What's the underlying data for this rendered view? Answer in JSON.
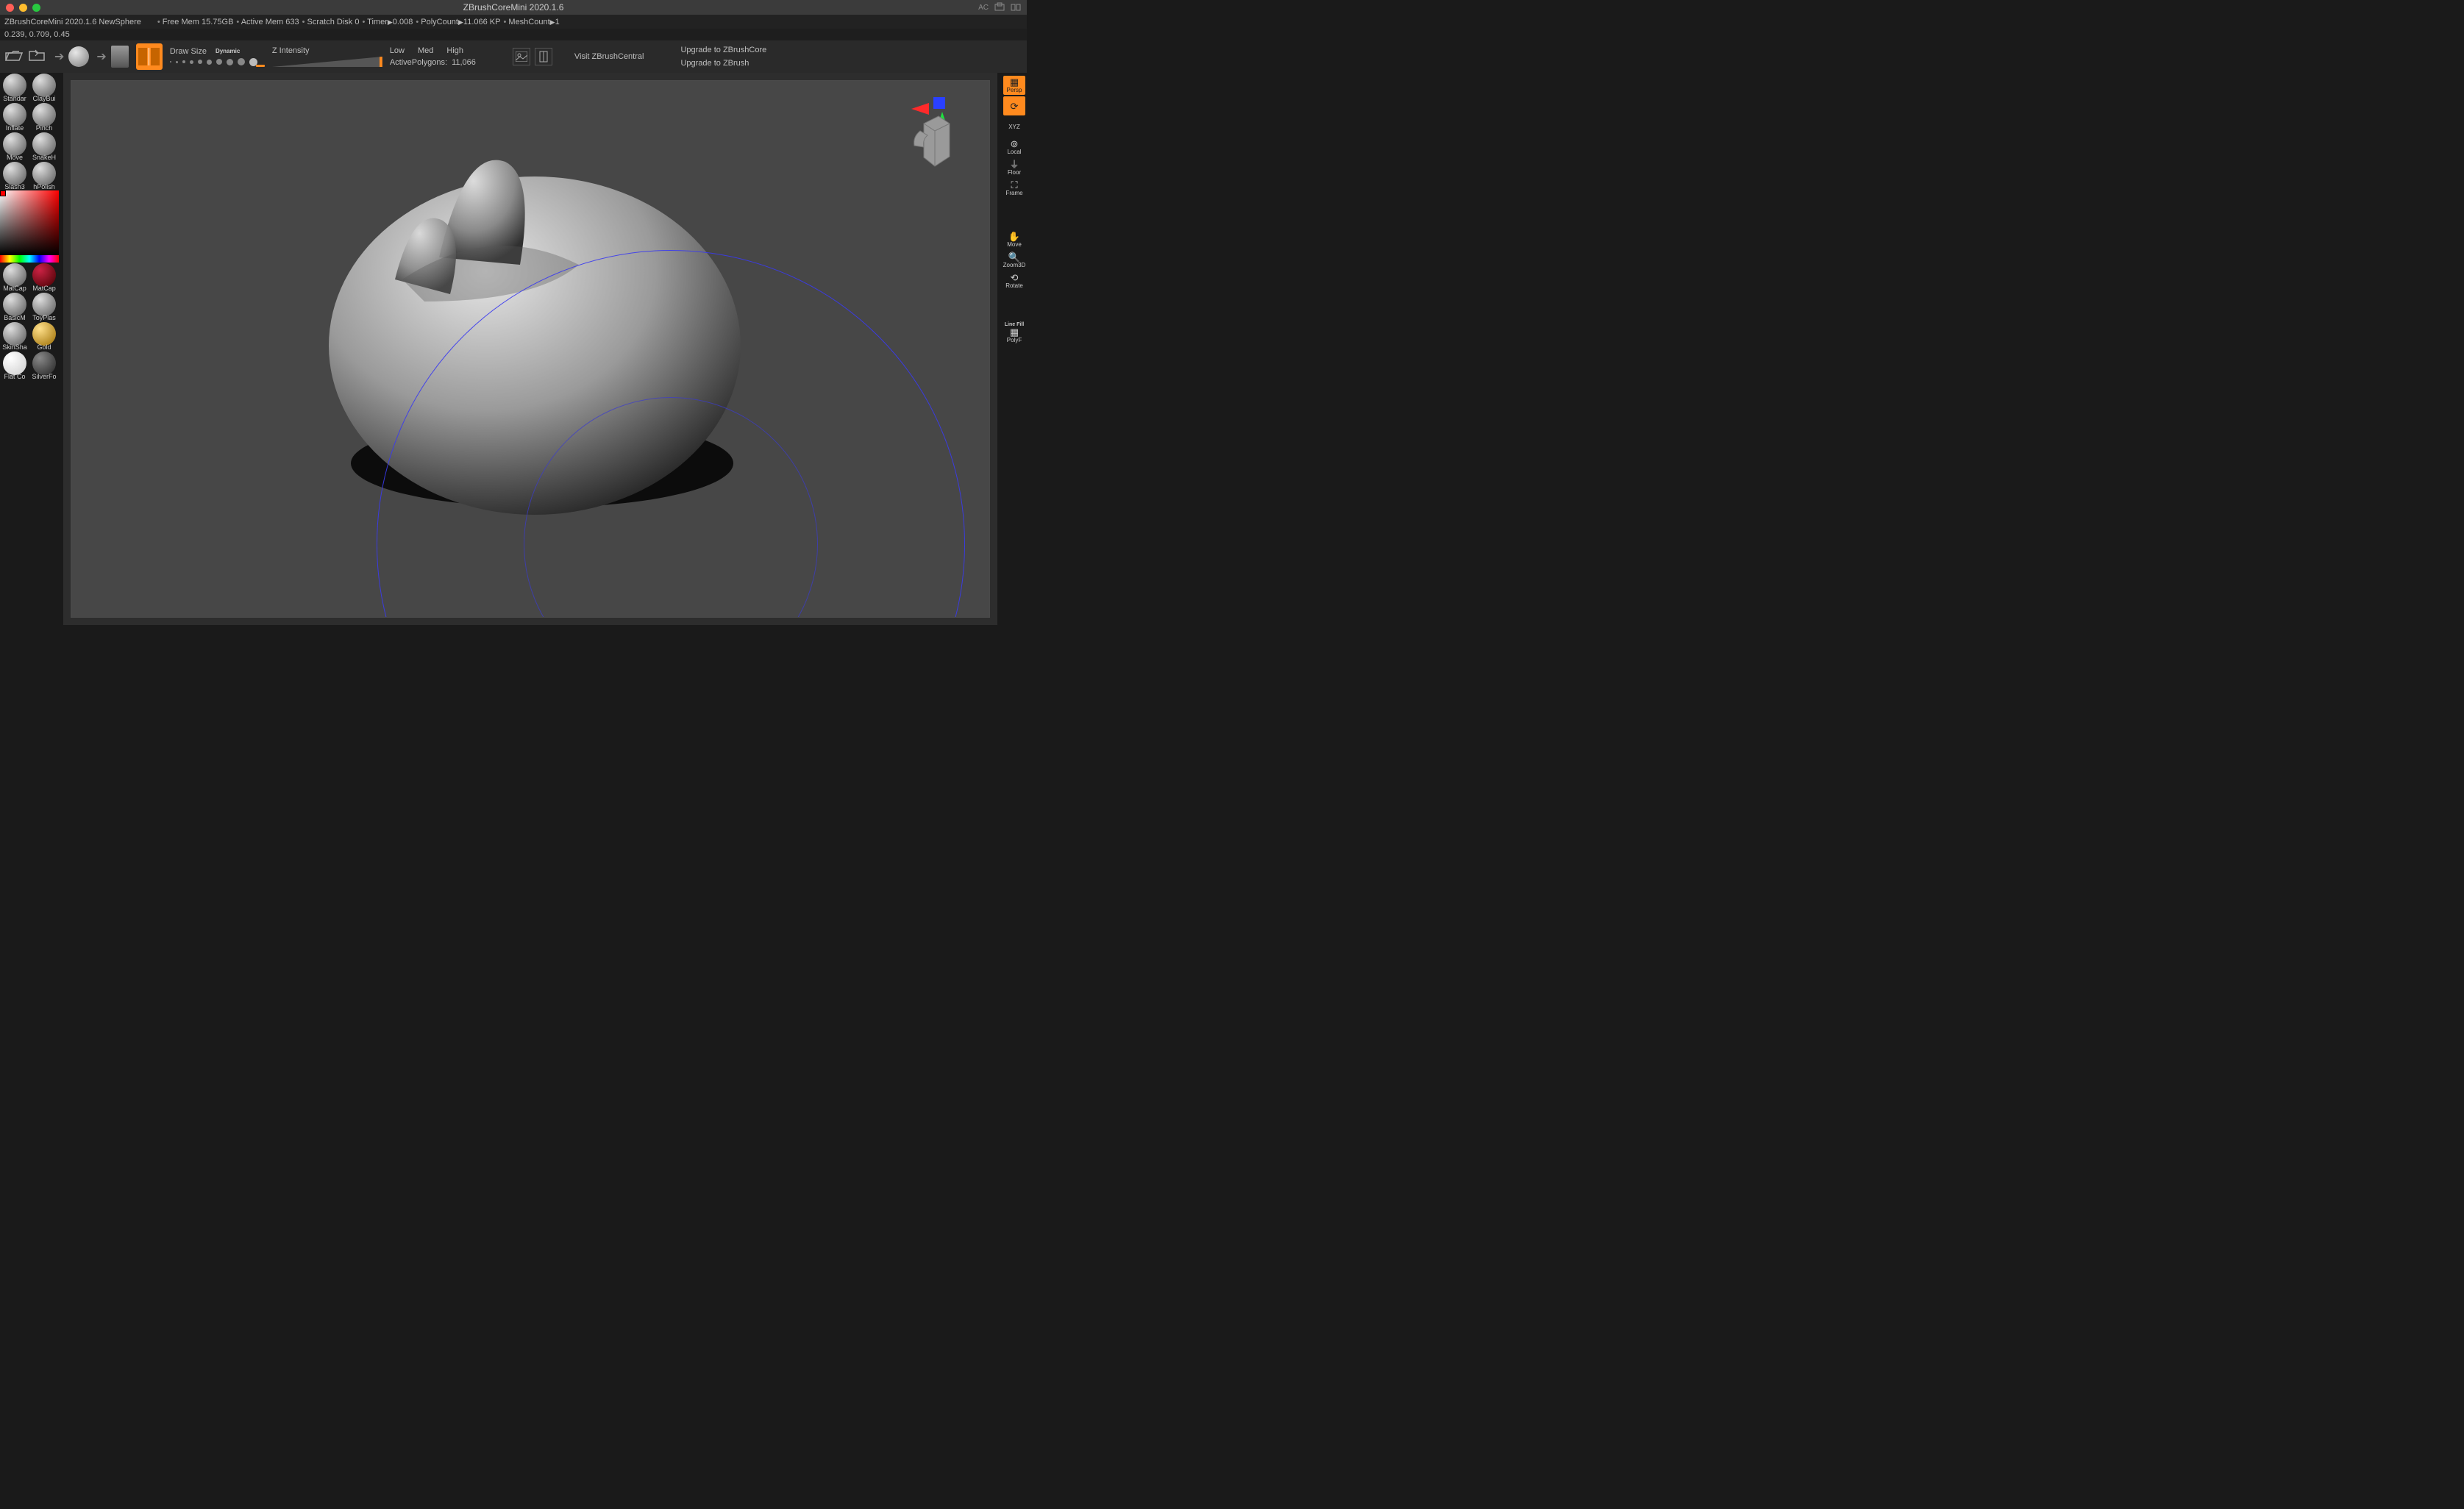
{
  "window": {
    "title": "ZBrushCoreMini 2020.1.6",
    "right_label": "AC"
  },
  "info": {
    "app": "ZBrushCoreMini 2020.1.6 NewSphere",
    "free_mem_label": "Free Mem ",
    "free_mem": "15.75GB",
    "active_mem_label": "Active Mem ",
    "active_mem": "633",
    "scratch_label": "Scratch Disk ",
    "scratch": "0",
    "timer_label": "Timer",
    "timer": "0.008",
    "poly_label": "PolyCount",
    "poly": "11.066 KP",
    "mesh_label": "MeshCount",
    "mesh": "1"
  },
  "coords": "0.239, 0.709, 0.45",
  "topbar": {
    "drawsize_label": "Draw Size",
    "dynamic_label": "Dynamic",
    "zintensity_label": "Z Intensity",
    "quality": {
      "low": "Low",
      "med": "Med",
      "high": "High"
    },
    "active_poly_label": "ActivePolygons:",
    "active_poly_value": "11,066",
    "visit": "Visit ZBrushCentral",
    "upgrade_core": "Upgrade to ZBrushCore",
    "upgrade_full": "Upgrade to ZBrush"
  },
  "brushes": [
    {
      "label": "Standar"
    },
    {
      "label": "ClayBui"
    },
    {
      "label": "Inflate"
    },
    {
      "label": "Pinch"
    },
    {
      "label": "Move"
    },
    {
      "label": "SnakeH"
    },
    {
      "label": "Slash3"
    },
    {
      "label": "hPolish"
    }
  ],
  "materials": [
    {
      "label": "MatCap",
      "cls": ""
    },
    {
      "label": "MatCap",
      "cls": "red"
    },
    {
      "label": "BasicM",
      "cls": ""
    },
    {
      "label": "ToyPlas",
      "cls": ""
    },
    {
      "label": "SkinSha",
      "cls": ""
    },
    {
      "label": "Gold",
      "cls": "gold"
    },
    {
      "label": "Flat Co",
      "cls": "white"
    },
    {
      "label": "SilverFo",
      "cls": "dark"
    }
  ],
  "right": {
    "persp": "Persp",
    "rotate_icon": "⟳",
    "xyz": "XYZ",
    "local": "Local",
    "floor": "Floor",
    "frame": "Frame",
    "move": "Move",
    "zoom": "Zoom3D",
    "rot": "Rotate",
    "linefill": "Line Fill",
    "polyf": "PolyF"
  }
}
